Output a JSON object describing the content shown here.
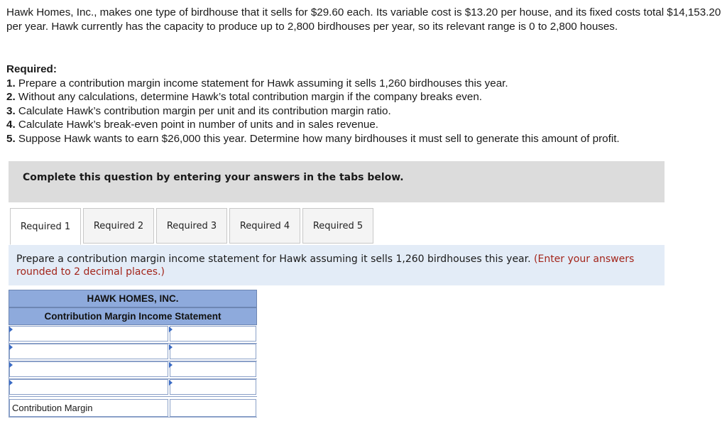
{
  "problem_text": "Hawk Homes, Inc., makes one type of birdhouse that it sells for $29.60 each. Its variable cost is $13.20 per house, and its fixed costs total $14,153.20 per year. Hawk currently has the capacity to produce up to 2,800 birdhouses per year, so its relevant range is 0 to 2,800 houses.",
  "required": {
    "heading": "Required:",
    "items": [
      {
        "num": "1.",
        "text": "Prepare a contribution margin income statement for Hawk assuming it sells 1,260 birdhouses this year."
      },
      {
        "num": "2.",
        "text": "Without any calculations, determine Hawk’s total contribution margin if the company breaks even."
      },
      {
        "num": "3.",
        "text": "Calculate Hawk’s contribution margin per unit and its contribution margin ratio."
      },
      {
        "num": "4.",
        "text": "Calculate Hawk’s break-even point in number of units and in sales revenue."
      },
      {
        "num": "5.",
        "text": "Suppose Hawk wants to earn $26,000 this year. Determine how many birdhouses it must sell to generate this amount of profit."
      }
    ]
  },
  "banner": "Complete this question by entering your answers in the tabs below.",
  "tabs": [
    "Required 1",
    "Required 2",
    "Required 3",
    "Required 4",
    "Required 5"
  ],
  "instruction": {
    "text": "Prepare a contribution margin income statement for Hawk assuming it sells 1,260 birdhouses this year.",
    "note": "(Enter your answers rounded to 2 decimal places.)"
  },
  "statement": {
    "company": "HAWK HOMES, INC.",
    "title": "Contribution Margin Income Statement",
    "rows": [
      "",
      "",
      "",
      "",
      "Contribution Margin"
    ],
    "values": [
      "",
      "",
      "",
      "",
      ""
    ]
  },
  "colors": {
    "header_blue": "#8eaadc",
    "instruction_bg": "#e3ecf7",
    "note_red": "#a3251b",
    "banner_gray": "#dcdcdc"
  }
}
